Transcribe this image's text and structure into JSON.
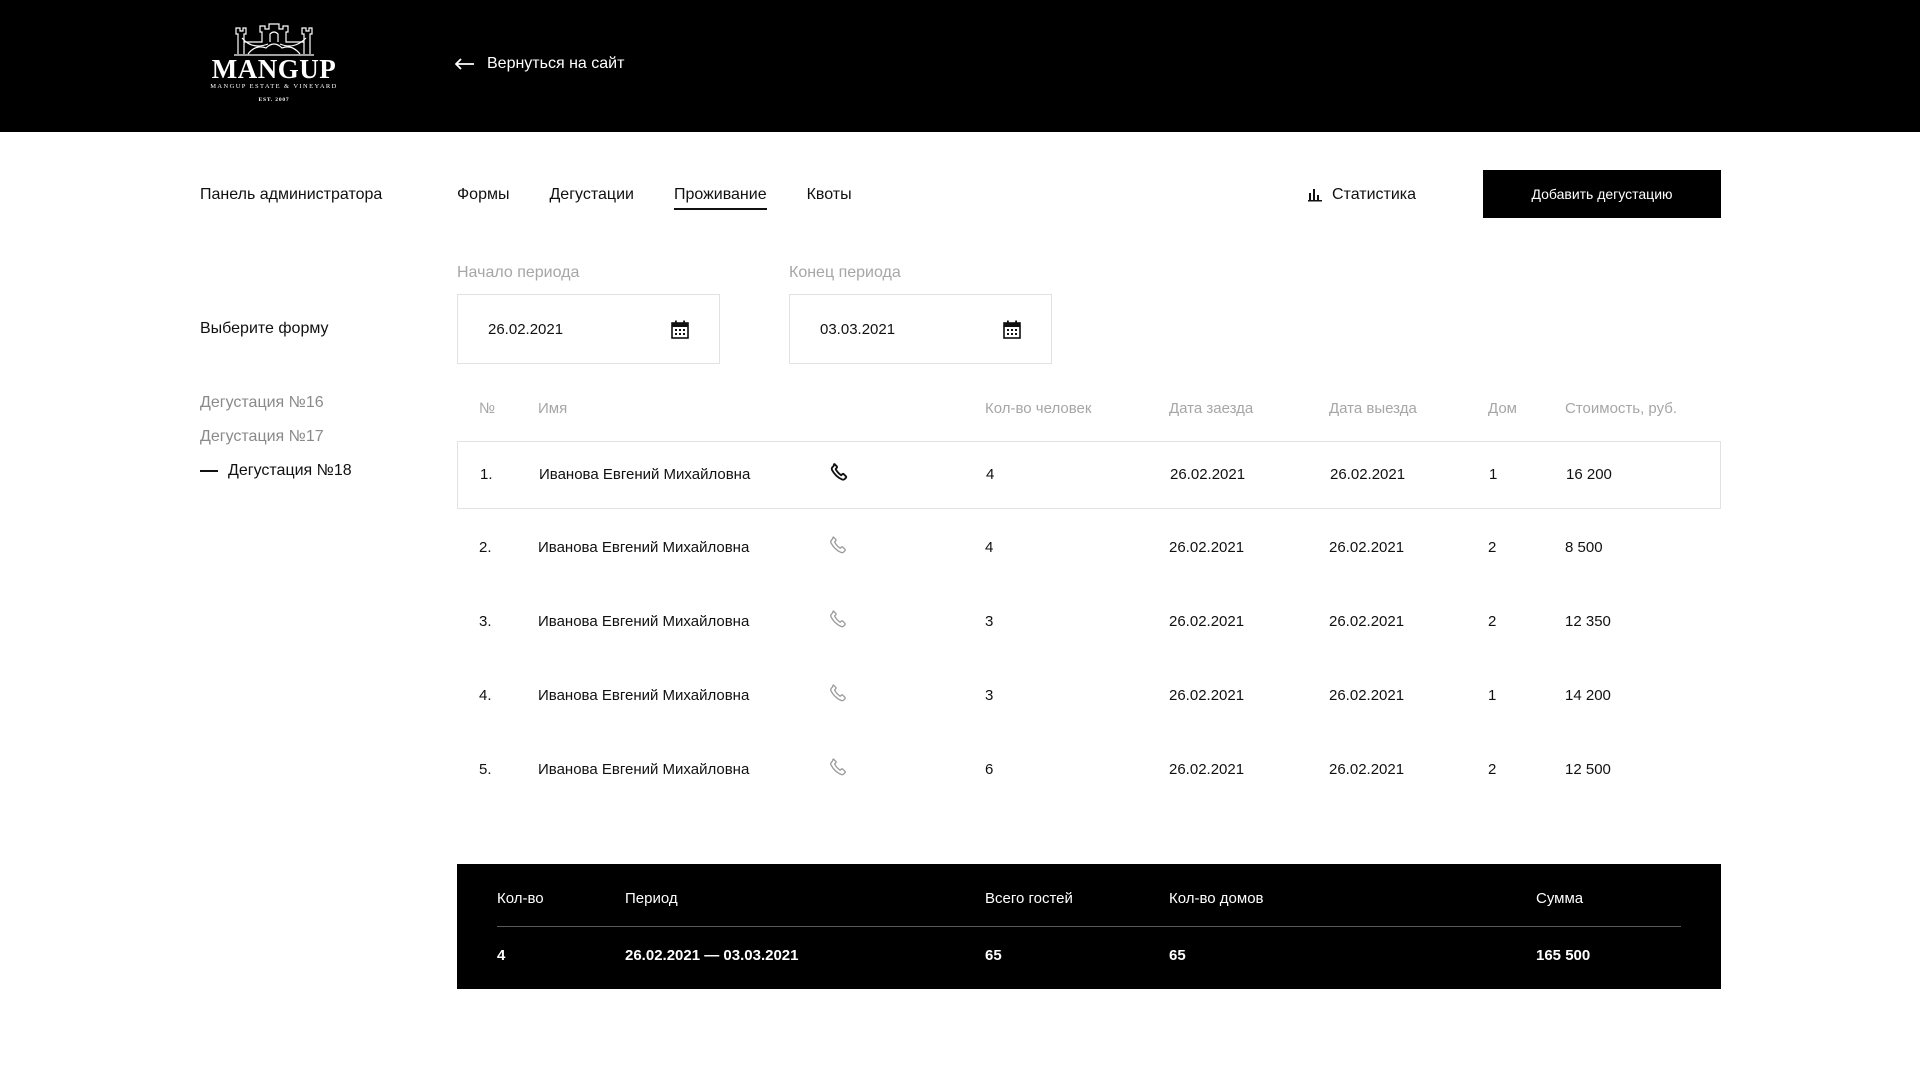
{
  "header": {
    "logo_name": "MANGUP",
    "logo_sub": "MANGUP ESTATE & VINEYARD",
    "logo_est": "EST. 2007",
    "back_label": "Вернуться на сайт"
  },
  "nav": {
    "panel_title": "Панель администратора",
    "tabs": [
      {
        "label": "Формы",
        "active": false
      },
      {
        "label": "Дегустации",
        "active": false
      },
      {
        "label": "Проживание",
        "active": true
      },
      {
        "label": "Квоты",
        "active": false
      }
    ],
    "stats_label": "Статистика",
    "add_button": "Добавить дегустацию"
  },
  "sidebar": {
    "heading": "Выберите форму",
    "items": [
      {
        "label": "Дегустация №16",
        "active": false
      },
      {
        "label": "Дегустация №17",
        "active": false
      },
      {
        "label": "Дегустация №18",
        "active": true
      }
    ]
  },
  "filters": {
    "start_label": "Начало периода",
    "start_value": "26.02.2021",
    "end_label": "Конец периода",
    "end_value": "03.03.2021"
  },
  "table": {
    "headers": {
      "num": "№",
      "name": "Имя",
      "people": "Кол-во человек",
      "checkin": "Дата заезда",
      "checkout": "Дата выезда",
      "house": "Дом",
      "cost": "Стоимость, руб."
    },
    "rows": [
      {
        "num": "1.",
        "name": "Иванова Евгений Михайловна",
        "people": "4",
        "checkin": "26.02.2021",
        "checkout": "26.02.2021",
        "house": "1",
        "cost": "16 200",
        "selected": true
      },
      {
        "num": "2.",
        "name": "Иванова Евгений Михайловна",
        "people": "4",
        "checkin": "26.02.2021",
        "checkout": "26.02.2021",
        "house": "2",
        "cost": "8 500",
        "selected": false
      },
      {
        "num": "3.",
        "name": "Иванова Евгений Михайловна",
        "people": "3",
        "checkin": "26.02.2021",
        "checkout": "26.02.2021",
        "house": "2",
        "cost": "12 350",
        "selected": false
      },
      {
        "num": "4.",
        "name": "Иванова Евгений Михайловна",
        "people": "3",
        "checkin": "26.02.2021",
        "checkout": "26.02.2021",
        "house": "1",
        "cost": "14 200",
        "selected": false
      },
      {
        "num": "5.",
        "name": "Иванова Евгений Михайловна",
        "people": "6",
        "checkin": "26.02.2021",
        "checkout": "26.02.2021",
        "house": "2",
        "cost": "12 500",
        "selected": false
      }
    ]
  },
  "summary": {
    "headers": {
      "qty": "Кол-во",
      "period": "Период",
      "guests": "Всего гостей",
      "houses": "Кол-во домов",
      "sum": "Сумма"
    },
    "values": {
      "qty": "4",
      "period": "26.02.2021 — 03.03.2021",
      "guests": "65",
      "houses": "65",
      "sum": "165 500"
    }
  },
  "icons": {
    "back": "arrow-left-icon",
    "stats": "bar-chart-icon",
    "calendar": "calendar-icon",
    "phone": "phone-icon"
  }
}
